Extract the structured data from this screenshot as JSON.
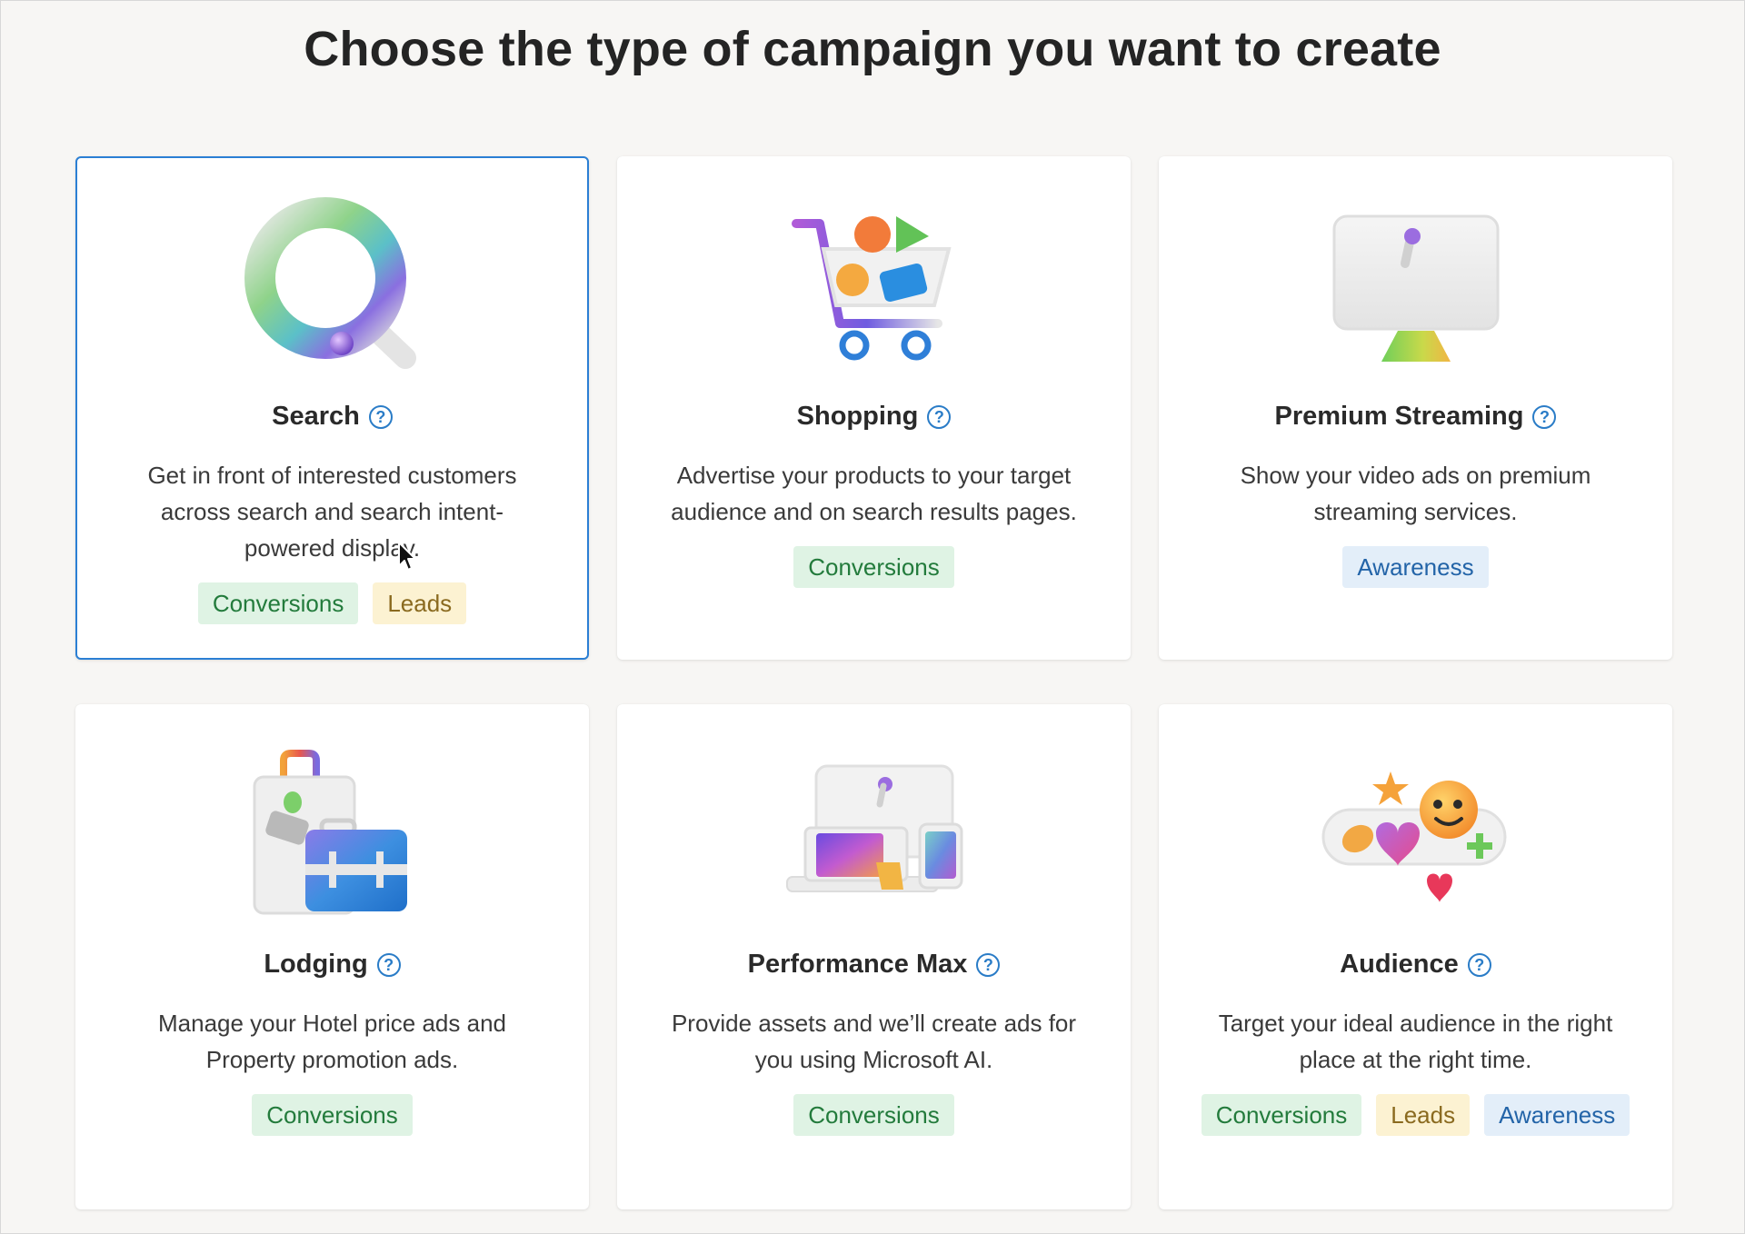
{
  "page": {
    "title": "Choose the type of campaign you want to create"
  },
  "colors": {
    "selected_border": "#2b7fd4",
    "help_icon": "#2a7cc7",
    "tag_conversions_bg": "#dff3e4",
    "tag_leads_bg": "#fcf2d2",
    "tag_awareness_bg": "#e3eef9"
  },
  "cards": [
    {
      "id": "search",
      "title": "Search",
      "help_icon": "question-circle-icon",
      "illustration": "magnifier-illustration",
      "description": "Get in front of interested customers across search and search intent-powered display.",
      "selected": true,
      "tags": [
        "Conversions",
        "Leads"
      ]
    },
    {
      "id": "shopping",
      "title": "Shopping",
      "help_icon": "question-circle-icon",
      "illustration": "shopping-cart-illustration",
      "description": "Advertise your products to your target audience and on search results pages.",
      "selected": false,
      "tags": [
        "Conversions"
      ]
    },
    {
      "id": "premium-streaming",
      "title": "Premium Streaming",
      "help_icon": "question-circle-icon",
      "illustration": "monitor-illustration",
      "description": "Show your video ads on premium streaming services.",
      "selected": false,
      "tags": [
        "Awareness"
      ]
    },
    {
      "id": "lodging",
      "title": "Lodging",
      "help_icon": "question-circle-icon",
      "illustration": "luggage-illustration",
      "description": "Manage your Hotel price ads and Property promotion ads.",
      "selected": false,
      "tags": [
        "Conversions"
      ]
    },
    {
      "id": "performance-max",
      "title": "Performance Max",
      "help_icon": "question-circle-icon",
      "illustration": "devices-illustration",
      "description": "Provide assets and we’ll create ads for you using Microsoft AI.",
      "selected": false,
      "tags": [
        "Conversions"
      ]
    },
    {
      "id": "audience",
      "title": "Audience",
      "help_icon": "question-circle-icon",
      "illustration": "emoji-reactions-illustration",
      "description": "Target your ideal audience in the right place at the right time.",
      "selected": false,
      "tags": [
        "Conversions",
        "Leads",
        "Awareness"
      ]
    }
  ],
  "help_glyph": "?"
}
